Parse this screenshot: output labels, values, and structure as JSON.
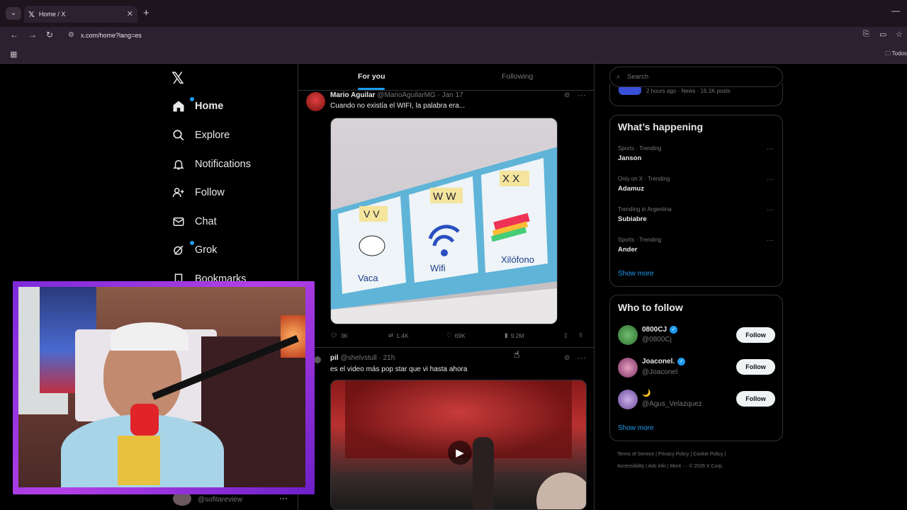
{
  "browser": {
    "tab_title": "Home / X",
    "url": "x.com/home?lang=es",
    "bookmark_folder": "Todos"
  },
  "nav": {
    "items": [
      {
        "label": "Home",
        "icon": "home-icon"
      },
      {
        "label": "Explore",
        "icon": "search-icon"
      },
      {
        "label": "Notifications",
        "icon": "bell-icon"
      },
      {
        "label": "Follow",
        "icon": "person-add-icon"
      },
      {
        "label": "Chat",
        "icon": "mail-icon"
      },
      {
        "label": "Grok",
        "icon": "grok-icon"
      },
      {
        "label": "Bookmarks",
        "icon": "bookmark-icon"
      }
    ],
    "account_handle": "@sofitareview"
  },
  "feed": {
    "tabs": [
      "For you",
      "Following"
    ],
    "posts": [
      {
        "name": "Mario Aguilar",
        "handle": "@MarioAguilarMG",
        "date": "· Jan 17",
        "text": "Cuando no existía el WIFI, la palabra era...",
        "media_labels": [
          "Vaca",
          "Wifi",
          "Xilófono"
        ],
        "replies": "3K",
        "reposts": "1.4K",
        "likes": "69K",
        "views": "9.2M"
      },
      {
        "name": "pil",
        "handle": "@shelvstull",
        "date": "· 21h",
        "text": "es el video más pop star que vi hasta ahora"
      }
    ]
  },
  "sidebar": {
    "search_placeholder": "Search",
    "prev_meta": "2 hours ago · News · 16.1K posts",
    "whats_happening": {
      "title": "What’s happening",
      "trends": [
        {
          "meta": "Sports · Trending",
          "name": "Janson"
        },
        {
          "meta": "Only on X · Trending",
          "name": "Adamuz"
        },
        {
          "meta": "Trending in Argentina",
          "name": "Subiabre"
        },
        {
          "meta": "Sports · Trending",
          "name": "Ander"
        }
      ],
      "show_more": "Show more"
    },
    "who_to_follow": {
      "title": "Who to follow",
      "users": [
        {
          "name": "0800CJ",
          "handle": "@0800Cj",
          "verified": true
        },
        {
          "name": "Joaconel.",
          "handle": "@Joaconel",
          "verified": true
        },
        {
          "name": "🌙",
          "handle": "@Agus_Velazquez",
          "verified": false
        }
      ],
      "follow_label": "Follow",
      "show_more": "Show more"
    },
    "footer": {
      "line1": [
        "Terms of Service",
        "Privacy Policy",
        "Cookie Policy"
      ],
      "line2": [
        "Accessibility",
        "Ads info",
        "More ···",
        "© 2026 X Corp."
      ]
    }
  },
  "colors": {
    "accent": "#1d9bf0",
    "background": "#000000",
    "border": "#2f3336",
    "muted": "#71767b",
    "cam_frame": "#9b35e0"
  }
}
